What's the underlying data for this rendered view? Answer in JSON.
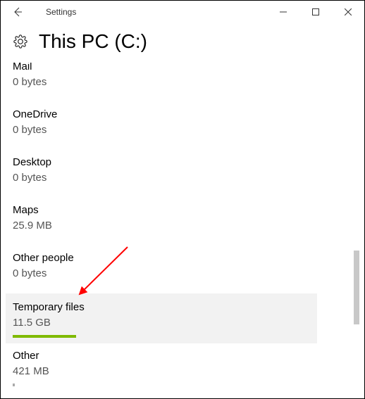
{
  "titlebar": {
    "app_title": "Settings"
  },
  "header": {
    "page_title": "This PC (C:)"
  },
  "storage": {
    "items": [
      {
        "name": "Mail",
        "size": "0 bytes"
      },
      {
        "name": "OneDrive",
        "size": "0 bytes"
      },
      {
        "name": "Desktop",
        "size": "0 bytes"
      },
      {
        "name": "Maps",
        "size": "25.9 MB"
      },
      {
        "name": "Other people",
        "size": "0 bytes"
      },
      {
        "name": "Temporary files",
        "size": "11.5 GB"
      },
      {
        "name": "Other",
        "size": "421 MB"
      }
    ]
  },
  "colors": {
    "accent": "#7fba00",
    "annotation_arrow": "#ff0000"
  }
}
